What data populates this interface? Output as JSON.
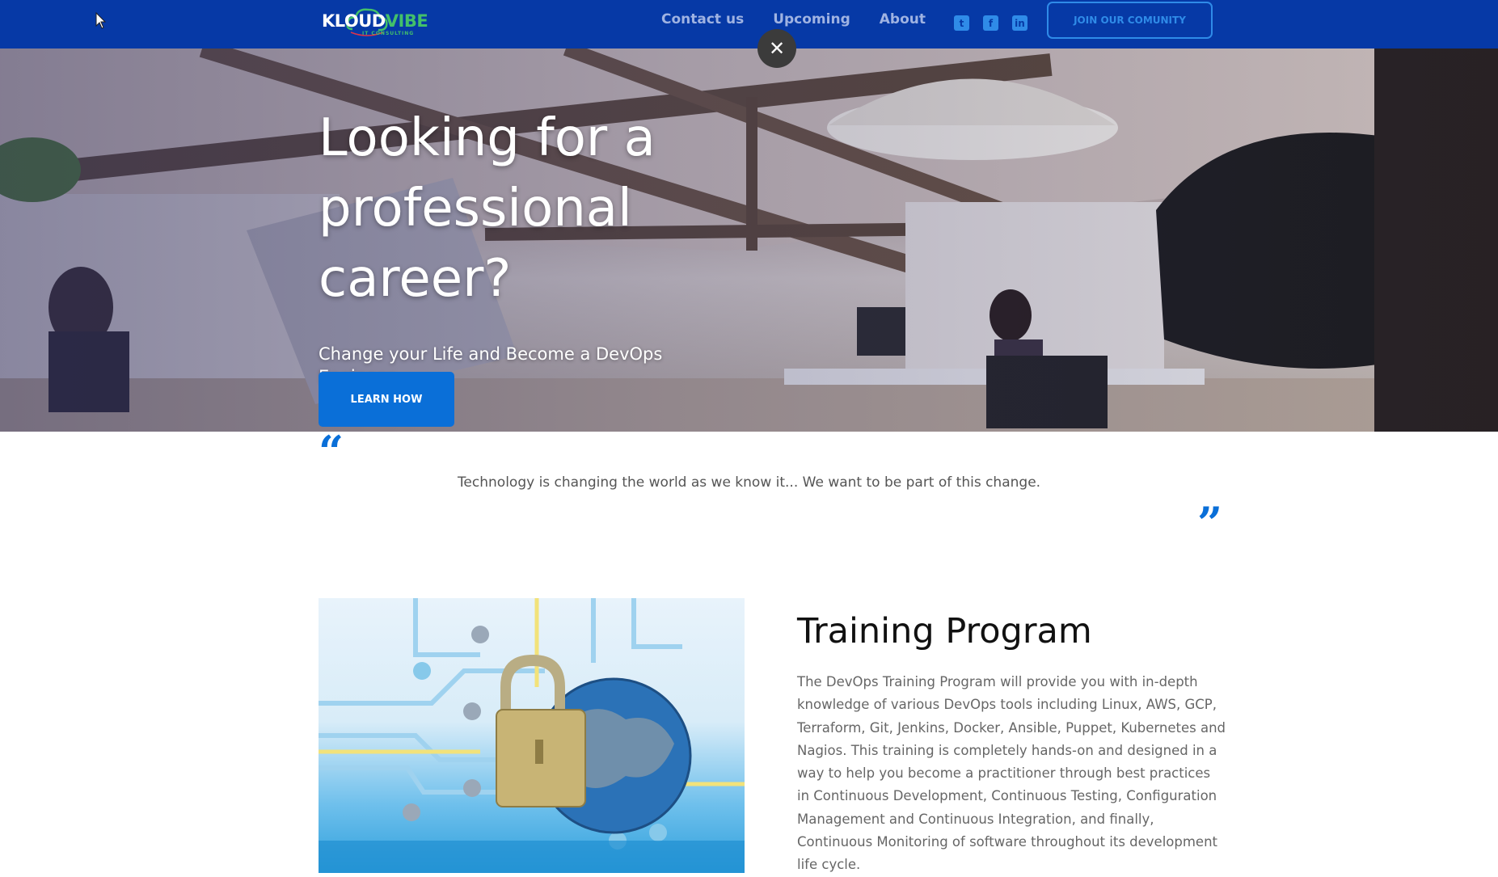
{
  "nav": {
    "logo_main": "KLOUD",
    "logo_accent": "VIBE",
    "logo_sub": "IT CONSULTING",
    "links": [
      "Contact us",
      "Upcoming",
      "About"
    ],
    "social": [
      {
        "icon": "twitter-icon",
        "glyph": "t"
      },
      {
        "icon": "facebook-icon",
        "glyph": "f"
      },
      {
        "icon": "linkedin-icon",
        "glyph": "in"
      }
    ],
    "join_label": "JOIN OUR COMUNITY"
  },
  "hero": {
    "title": "Looking for a professional career?",
    "subtitle": "Change your Life and Become a DevOps Engineer",
    "cta_label": "LEARN HOW",
    "close_label": "✕"
  },
  "quote": {
    "open_mark": "“",
    "text": "Technology is changing the world as we know it... We want to be part of this change.",
    "close_mark": "”"
  },
  "training": {
    "title": "Training Program",
    "description": "The DevOps Training Program will provide you with in-depth knowledge of various DevOps tools including Linux, AWS, GCP, Terraform, Git, Jenkins, Docker, Ansible, Puppet, Kubernetes and Nagios. This training is completely hands-on and designed in a way to help you become a practitioner through best practices in Continuous Development, Continuous Testing, Configuration Management and Continuous Integration, and finally, Continuous Monitoring of software throughout its development life cycle."
  },
  "colors": {
    "nav_bg": "#0639a6",
    "accent_blue": "#0a6fd8",
    "link_blue": "#2f8be8",
    "logo_green": "#43c06a"
  }
}
